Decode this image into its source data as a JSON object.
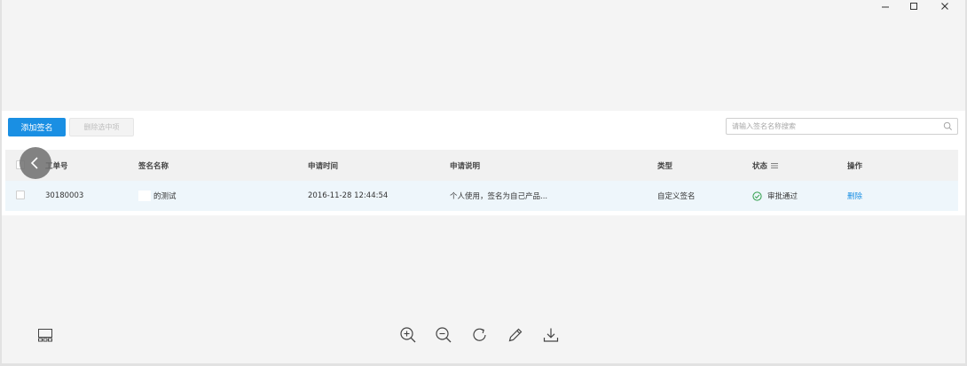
{
  "window": {
    "controls": [
      "minimize-icon",
      "maximize-icon",
      "close-icon"
    ]
  },
  "toolbar": {
    "add_label": "添加签名",
    "delete_selected_label": "删除选中项"
  },
  "search": {
    "placeholder": "请输入签名名称搜索",
    "value": ""
  },
  "table": {
    "headers": {
      "ticket_no": "工单号",
      "name": "签名名称",
      "apply_time": "申请时间",
      "description": "申请说明",
      "type": "类型",
      "status": "状态",
      "actions": "操作"
    },
    "rows": [
      {
        "ticket_no": "30180003",
        "name": "的测试",
        "apply_time": "2016-11-28 12:44:54",
        "description": "个人使用，签名为自己产品...",
        "type": "自定义签名",
        "status": "审批通过",
        "action": "删除"
      }
    ]
  },
  "colors": {
    "accent": "#1a8fe3",
    "success": "#2e9e4a",
    "row_highlight": "#eef6fb"
  },
  "viewer_tools": [
    "thumbnail-icon",
    "zoom-in-icon",
    "zoom-out-icon",
    "rotate-icon",
    "edit-icon",
    "download-icon"
  ]
}
